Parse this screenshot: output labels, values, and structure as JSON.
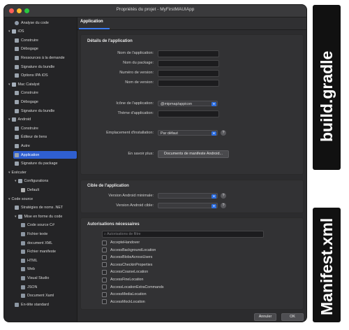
{
  "window": {
    "title": "Propriétés du projet - MyFirstMAUIApp"
  },
  "sidebar": {
    "items": [
      {
        "label": "Analyse du code",
        "depth": 1,
        "icon": "gear-icon"
      },
      {
        "label": "iOS",
        "depth": 0,
        "icon": "phone-icon",
        "chevron": true
      },
      {
        "label": "Construire",
        "depth": 1,
        "icon": "build-icon"
      },
      {
        "label": "Débogage",
        "depth": 1,
        "icon": "bug-icon"
      },
      {
        "label": "Ressources à la demande",
        "depth": 1,
        "icon": "resource-icon"
      },
      {
        "label": "Signature du bundle",
        "depth": 1,
        "icon": "signature-icon"
      },
      {
        "label": "Options IPA iOS",
        "depth": 1,
        "icon": "package-icon"
      },
      {
        "label": "Mac Catalyst",
        "depth": 0,
        "icon": "laptop-icon",
        "chevron": true
      },
      {
        "label": "Construire",
        "depth": 1,
        "icon": "build-icon"
      },
      {
        "label": "Débogage",
        "depth": 1,
        "icon": "bug-icon"
      },
      {
        "label": "Signature du bundle",
        "depth": 1,
        "icon": "signature-icon"
      },
      {
        "label": "Android",
        "depth": 0,
        "icon": "android-icon",
        "chevron": true
      },
      {
        "label": "Construire",
        "depth": 1,
        "icon": "build-icon"
      },
      {
        "label": "Éditeur de liens",
        "depth": 1,
        "icon": "link-icon"
      },
      {
        "label": "Autre",
        "depth": 1,
        "icon": "android-icon"
      },
      {
        "label": "Application",
        "depth": 1,
        "icon": "android-icon",
        "selected": true
      },
      {
        "label": "Signature du package",
        "depth": 1,
        "icon": "signature-icon"
      },
      {
        "label": "Exécuter",
        "depth": 0,
        "chevron": true
      },
      {
        "label": "Configurations",
        "depth": 1,
        "icon": "config-icon",
        "chevron": true
      },
      {
        "label": "Default",
        "depth": 2,
        "icon": "play-icon"
      },
      {
        "label": "Code source",
        "depth": 0,
        "chevron": true
      },
      {
        "label": "Stratégies de noms .NET",
        "depth": 1,
        "icon": "naming-icon"
      },
      {
        "label": "Mise en forme du code",
        "depth": 1,
        "icon": "format-icon",
        "chevron": true
      },
      {
        "label": "Code source C#",
        "depth": 2,
        "icon": "file-icon"
      },
      {
        "label": "Fichier texte",
        "depth": 2,
        "icon": "file-icon"
      },
      {
        "label": "document XML",
        "depth": 2,
        "icon": "file-icon"
      },
      {
        "label": "Fichier manifeste",
        "depth": 2,
        "icon": "file-icon"
      },
      {
        "label": "HTML",
        "depth": 2,
        "icon": "file-icon"
      },
      {
        "label": "Web",
        "depth": 2,
        "icon": "file-icon"
      },
      {
        "label": "Visual Studio",
        "depth": 2,
        "icon": "file-icon"
      },
      {
        "label": "JSON",
        "depth": 2,
        "icon": "file-icon"
      },
      {
        "label": "Document Xaml",
        "depth": 2,
        "icon": "file-icon"
      },
      {
        "label": "En-tête standard",
        "depth": 1,
        "icon": "file-icon"
      }
    ]
  },
  "tab": {
    "label": "Application"
  },
  "app_details": {
    "title": "Détails de l'application",
    "app_name_label": "Nom de l'application:",
    "package_name_label": "Nom du package:",
    "version_number_label": "Numéro de version:",
    "version_name_label": "Nom de version:",
    "icon_label": "Icône de l'application:",
    "icon_value": "@mipmap/appicon",
    "theme_label": "Thème d'application:",
    "install_location_label": "Emplacement d'installation:",
    "install_location_value": "Par défaut",
    "learn_more_label": "En savoir plus:",
    "manifest_docs_button": "Documents de manifeste Android..."
  },
  "target": {
    "title": "Cible de l'application",
    "min_label": "Version Android minimale:",
    "target_label": "Version Android cible:"
  },
  "permissions": {
    "title": "Autorisations nécessaires",
    "filter_placeholder": "Autorisations de filtre",
    "items": [
      "AccepteHandover",
      "AccessBackgroundLocation",
      "AccessBlobsAcrossUsers",
      "AccessCheckinProperties",
      "AccessCoarseLocation",
      "AccessFineLocation",
      "AccessLocationExtraCommands",
      "AccessMediaLocation",
      "AccessMockLocation"
    ]
  },
  "footer": {
    "cancel": "Annuler",
    "ok": "OK"
  },
  "annotations": {
    "build": "build.gradle",
    "manifest": "Manifest.xml"
  },
  "colors": {
    "accent": "#2f6fe0",
    "selected": "#2f5fd0",
    "window_bg": "#2b2b2d"
  }
}
